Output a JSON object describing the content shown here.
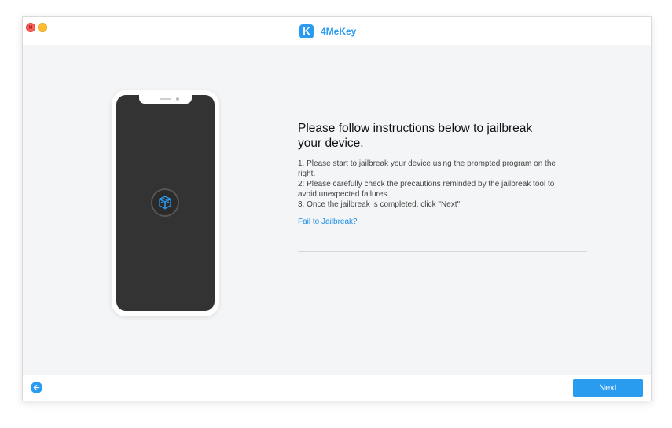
{
  "window": {
    "app_name": "4MeKey",
    "logo_letter": "K",
    "traffic_close_glyph": "×",
    "traffic_minimize_glyph": "−"
  },
  "main": {
    "heading": "Please follow instructions below to jailbreak your device.",
    "steps": [
      "1. Please start to jailbreak your device using the prompted program on the right.",
      "2: Please carefully check the precautions reminded by the jailbreak tool to avoid unexpected failures.",
      "3. Once the jailbreak is completed, click \"Next\"."
    ],
    "fail_link": "Fail to Jailbreak?"
  },
  "footer": {
    "next_label": "Next"
  },
  "colors": {
    "accent": "#2a9cf0",
    "close": "#fc5f57",
    "minimize": "#fdbb2e",
    "phone_screen": "#333333"
  },
  "icons": {
    "back": "arrow-left-icon",
    "jailbreak": "box-icon",
    "logo": "4mekey-logo-icon"
  }
}
